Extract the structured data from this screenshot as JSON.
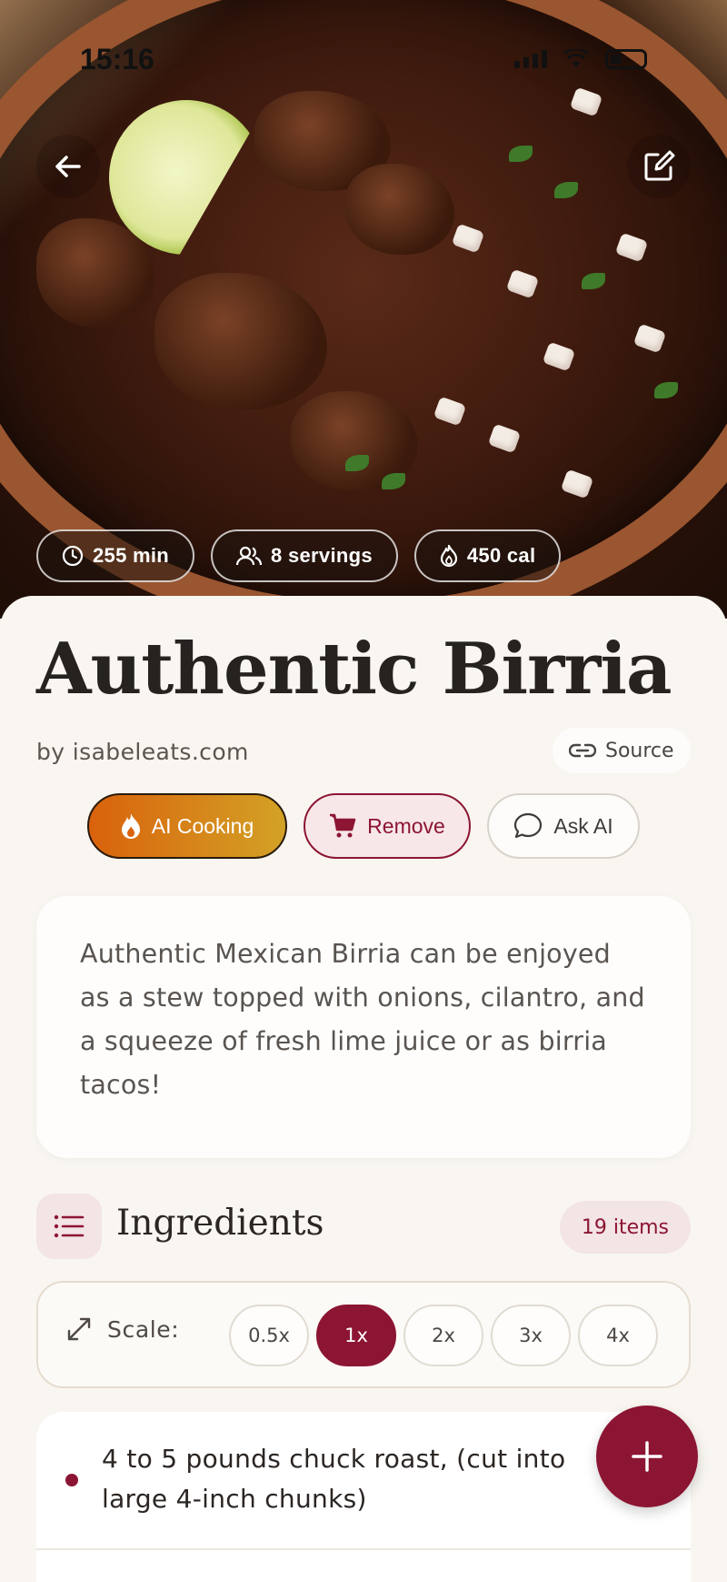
{
  "status_bar": {
    "time": "15:16"
  },
  "hero": {
    "chips": [
      {
        "icon": "clock-icon",
        "label": "255 min"
      },
      {
        "icon": "people-icon",
        "label": "8 servings"
      },
      {
        "icon": "flame-icon",
        "label": "450 cal"
      }
    ]
  },
  "recipe": {
    "title": "Authentic Birria",
    "byline": "by isabeleats.com",
    "source_label": "Source",
    "description": "Authentic Mexican Birria can be enjoyed as a stew topped with onions, cilantro, and a squeeze of fresh lime juice or as birria tacos!"
  },
  "actions": {
    "ai_cooking": "AI Cooking",
    "remove": "Remove",
    "ask_ai": "Ask AI"
  },
  "ingredients": {
    "title": "Ingredients",
    "count": "19 items",
    "scale_label": "Scale:",
    "scale_options": [
      "0.5x",
      "1x",
      "2x",
      "3x",
      "4x"
    ],
    "scale_selected": "1x",
    "items": [
      "4 to 5 pounds chuck roast, (cut into large 4-inch chunks)"
    ]
  },
  "colors": {
    "accent": "#8c1533",
    "ai_gradient_start": "#d9620c",
    "ai_gradient_end": "#d3a226"
  }
}
